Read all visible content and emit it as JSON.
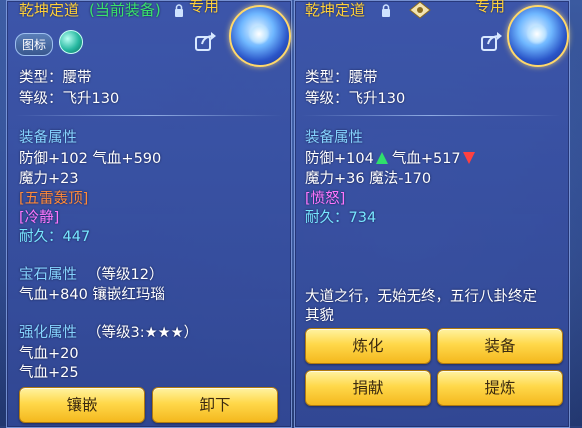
{
  "left": {
    "name": "乾坤定道",
    "equipped_tag": "(当前装备)",
    "exclusive_label": "专用",
    "icon_tag": "图标",
    "type_line": "类型：腰带",
    "level_line": "等级：飞升130",
    "attr_header": "装备属性",
    "stats_line1": "防御+102 气血+590",
    "stats_line2": "魔力+23",
    "special_skill": "[五雷轰顶]",
    "special_effect": "[冷静]",
    "durability": "耐久：447",
    "gem_header": "宝石属性",
    "gem_level": "（等级12）",
    "gem_line": "气血+840 镶嵌红玛瑙",
    "enhance_header": "强化属性",
    "enhance_level": "（等级3:★★★）",
    "enhance_line1": "气血+20",
    "enhance_line2": "气血+25",
    "buttons": [
      "镶嵌",
      "卸下"
    ]
  },
  "right": {
    "name": "乾坤定道",
    "exclusive_label": "专用",
    "type_line": "类型：腰带",
    "level_line": "等级：飞升130",
    "attr_header": "装备属性",
    "def_text": "防御+104",
    "hp_text": "气血+517",
    "stats_line2": "魔力+36 魔法-170",
    "special_effect": "[愤怒]",
    "durability": "耐久：734",
    "description_line1": "大道之行，无始无终，五行八卦终定",
    "description_line2": "其貌",
    "buttons": [
      "炼化",
      "装备",
      "捐献",
      "提炼"
    ]
  },
  "colors": {
    "name": "#ffd13a",
    "equipped": "#39e36b",
    "section": "#86d4ff",
    "skill": "#ff8a3a",
    "effect": "#ff77ff",
    "durability": "#78e7ff",
    "button": "#ffd84a"
  },
  "icons": [
    "lock-icon",
    "gem-icon",
    "share-icon",
    "emblem-icon",
    "medal-icon",
    "arrow-up-icon",
    "arrow-down-icon"
  ]
}
